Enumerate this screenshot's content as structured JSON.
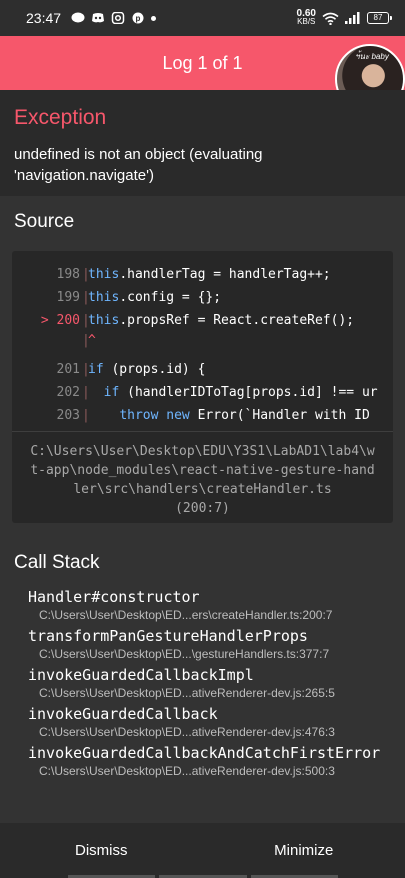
{
  "status_bar": {
    "time": "23:47",
    "speed_value": "0.60",
    "speed_unit": "KB/S",
    "battery": "87"
  },
  "header": {
    "title": "Log 1 of 1",
    "avatar_text": "ฯ้นะ baby"
  },
  "exception": {
    "title": "Exception",
    "message": "undefined is not an object (evaluating 'navigation.navigate')"
  },
  "source": {
    "title": "Source",
    "file_path": "C:\\Users\\User\\Desktop\\EDU\\Y3S1\\LabAD1\\lab4\\wt-app\\node_modules\\react-native-gesture-handler\\src\\handlers\\createHandler.ts",
    "position": "(200:7)",
    "lines": [
      {
        "num": "198",
        "pre": "",
        "kw": "this",
        "code": ".handlerTag = handlerTag++;"
      },
      {
        "num": "199",
        "pre": "",
        "kw": "this",
        "code": ".config = {};"
      },
      {
        "num": "> 200",
        "pre": "",
        "kw": "this",
        "code": ".propsRef = React.createRef();"
      },
      {
        "num": "",
        "pre": "",
        "kw": "",
        "code": "^"
      },
      {
        "num": "201",
        "pre": "",
        "kw": "if",
        "code": " (props.id) {"
      },
      {
        "num": "202",
        "pre": "  ",
        "kw": "if",
        "code": " (handlerIDToTag[props.id] !== ur"
      },
      {
        "num": "203",
        "pre": "    ",
        "kw": "throw new",
        "code": " Error(`Handler with ID"
      }
    ]
  },
  "call_stack": {
    "title": "Call Stack",
    "frames": [
      {
        "fn": "Handler#constructor",
        "loc": "C:\\Users\\User\\Desktop\\ED...ers\\createHandler.ts:200:7"
      },
      {
        "fn": "transformPanGestureHandlerProps",
        "loc": "C:\\Users\\User\\Desktop\\ED...\\gestureHandlers.ts:377:7"
      },
      {
        "fn": "invokeGuardedCallbackImpl",
        "loc": "C:\\Users\\User\\Desktop\\ED...ativeRenderer-dev.js:265:5"
      },
      {
        "fn": "invokeGuardedCallback",
        "loc": "C:\\Users\\User\\Desktop\\ED...ativeRenderer-dev.js:476:3"
      },
      {
        "fn": "invokeGuardedCallbackAndCatchFirstError",
        "loc": "C:\\Users\\User\\Desktop\\ED...ativeRenderer-dev.js:500:3"
      }
    ]
  },
  "footer": {
    "dismiss_label": "Dismiss",
    "minimize_label": "Minimize"
  },
  "colors": {
    "accent": "#f6576b",
    "background": "#333333",
    "code_bg": "#272727",
    "keyword": "#6fb6ff"
  }
}
